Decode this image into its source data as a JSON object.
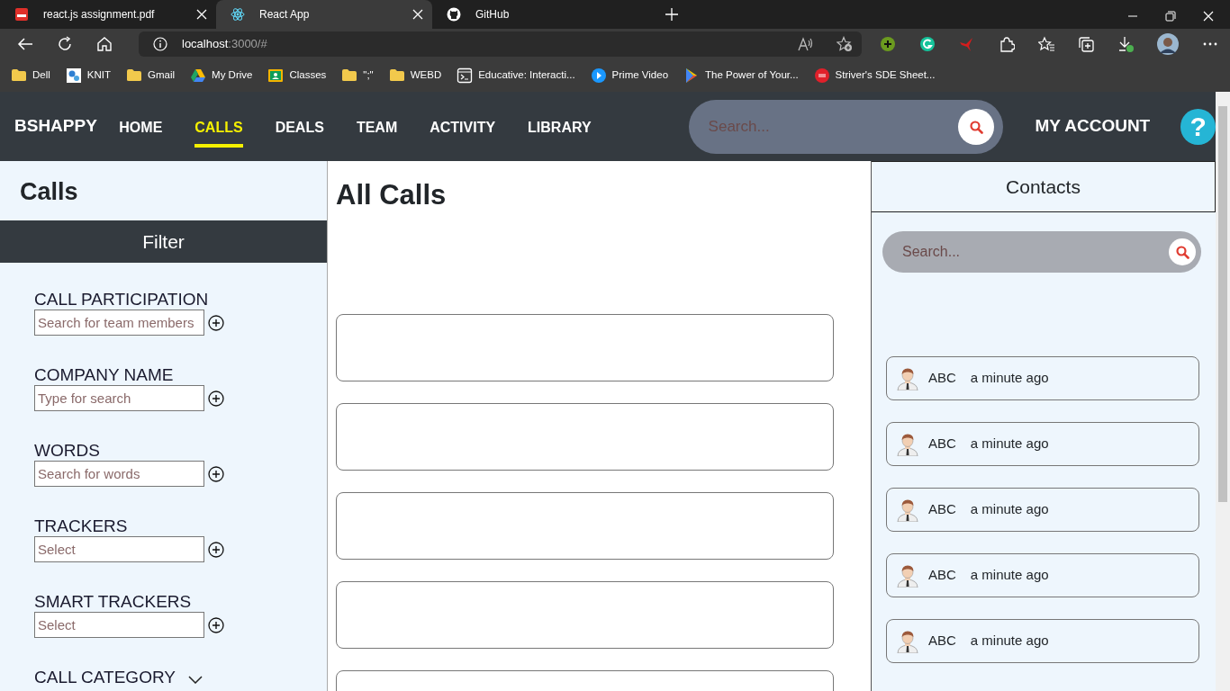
{
  "browser": {
    "tabs": [
      {
        "title": "react.js assignment.pdf",
        "selected": false
      },
      {
        "title": "React App",
        "selected": true
      },
      {
        "title": "GitHub",
        "selected": false
      }
    ],
    "address": {
      "host": "localhost",
      "rest": ":3000/#"
    },
    "bookmarks": [
      {
        "label": "Dell"
      },
      {
        "label": "KNIT"
      },
      {
        "label": "Gmail"
      },
      {
        "label": "My Drive"
      },
      {
        "label": "Classes"
      },
      {
        "label": "\";\""
      },
      {
        "label": "WEBD"
      },
      {
        "label": "Educative: Interacti..."
      },
      {
        "label": "Prime Video"
      },
      {
        "label": "The Power of Your..."
      },
      {
        "label": "Striver's SDE Sheet..."
      }
    ]
  },
  "navbar": {
    "brand": "BSHAPPY",
    "links": [
      {
        "label": "HOME",
        "selected": false
      },
      {
        "label": "CALLS",
        "selected": true
      },
      {
        "label": "DEALS",
        "selected": false
      },
      {
        "label": "TEAM",
        "selected": false
      },
      {
        "label": "ACTIVITY",
        "selected": false
      },
      {
        "label": "LIBRARY",
        "selected": false
      }
    ],
    "search": {
      "placeholder": "Search..."
    },
    "account": "MY ACCOUNT",
    "help": "?"
  },
  "sidebar": {
    "title": "Calls",
    "filter_header": "Filter",
    "filters": [
      {
        "kind": "input",
        "label": "CALL PARTICIPATION",
        "placeholder": "Search for team members"
      },
      {
        "kind": "input",
        "label": "COMPANY NAME",
        "placeholder": "Type for search"
      },
      {
        "kind": "input",
        "label": "WORDS",
        "placeholder": "Search for words"
      },
      {
        "kind": "input",
        "label": "TRACKERS",
        "placeholder": "Select"
      },
      {
        "kind": "input",
        "label": "SMART TRACKERS",
        "placeholder": "Select"
      },
      {
        "kind": "collapsible",
        "label": "CALL CATEGORY",
        "expanded": false
      }
    ]
  },
  "main": {
    "title": "All Calls",
    "call_cards": [
      {
        "kind": "blank"
      },
      {
        "kind": "blank"
      },
      {
        "kind": "blank"
      },
      {
        "kind": "blank"
      },
      {
        "kind": "blank"
      }
    ]
  },
  "contacts": {
    "title": "Contacts",
    "search": {
      "placeholder": "Search..."
    },
    "items": [
      {
        "name": "ABC",
        "time": "a minute ago"
      },
      {
        "name": "ABC",
        "time": "a minute ago"
      },
      {
        "name": "ABC",
        "time": "a minute ago"
      },
      {
        "name": "ABC",
        "time": "a minute ago"
      },
      {
        "name": "ABC",
        "time": "a minute ago"
      }
    ]
  }
}
